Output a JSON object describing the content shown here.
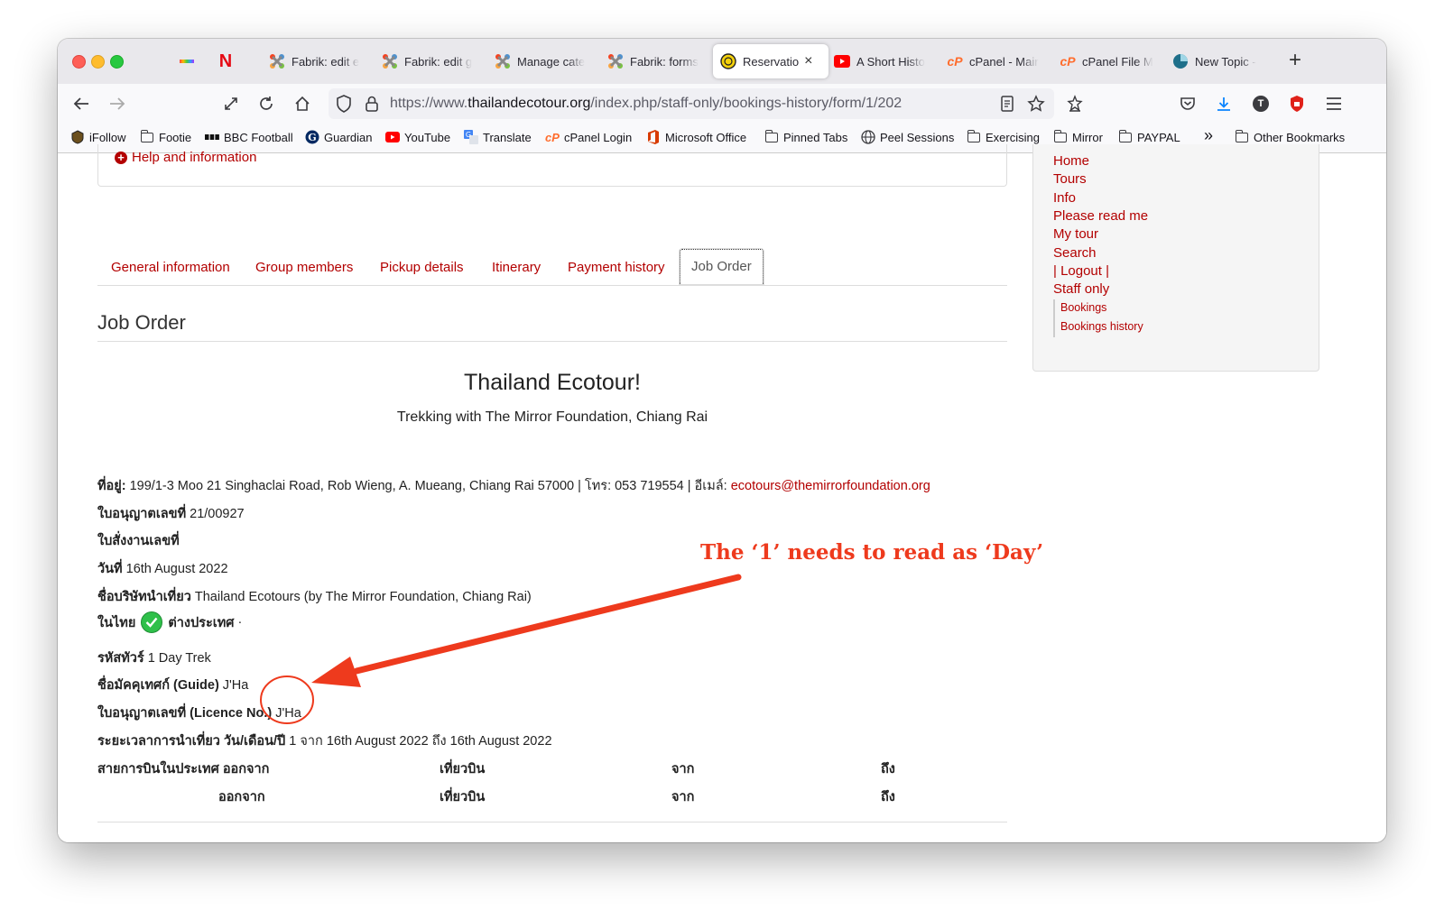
{
  "browser": {
    "tabs": [
      {
        "label": "Fabrik: edit e",
        "icon": "joomla-icon"
      },
      {
        "label": "Fabrik: edit g",
        "icon": "joomla-icon"
      },
      {
        "label": "Manage cate",
        "icon": "joomla-icon"
      },
      {
        "label": "Fabrik: forms",
        "icon": "joomla-icon"
      },
      {
        "label": "Reservatio",
        "icon": "site-logo-icon",
        "active": true
      },
      {
        "label": "A Short Histo",
        "icon": "youtube-icon"
      },
      {
        "label": "cPanel - Mair",
        "icon": "cpanel-icon"
      },
      {
        "label": "cPanel File M",
        "icon": "cpanel-icon"
      },
      {
        "label": "New Topic - ",
        "icon": "forum-icon"
      }
    ],
    "new_tab_label": "+",
    "close_label": "×",
    "url": {
      "scheme": "https://www.",
      "domain": "thailandecotour.org",
      "path": "/index.php/staff-only/bookings-history/form/1/202"
    },
    "bookmarks": [
      {
        "label": "iFollow",
        "icon": "ifollow-icon"
      },
      {
        "label": "Footie",
        "icon": "folder-icon"
      },
      {
        "label": "BBC Football",
        "icon": "bbc-icon"
      },
      {
        "label": "Guardian",
        "icon": "guardian-icon"
      },
      {
        "label": "YouTube",
        "icon": "youtube-icon"
      },
      {
        "label": "Translate",
        "icon": "translate-icon"
      },
      {
        "label": "cPanel Login",
        "icon": "cpanel-icon"
      },
      {
        "label": "Microsoft Office",
        "icon": "office-icon"
      },
      {
        "label": "Pinned Tabs",
        "icon": "folder-icon"
      },
      {
        "label": "Peel Sessions",
        "icon": "globe-icon"
      },
      {
        "label": "Exercising",
        "icon": "folder-icon"
      },
      {
        "label": "Mirror",
        "icon": "folder-icon"
      },
      {
        "label": "PAYPAL",
        "icon": "folder-icon"
      }
    ],
    "overflow_label": "»",
    "other_bookmarks": "Other Bookmarks"
  },
  "page": {
    "help_link": "Help and information",
    "tabs": [
      "General information",
      "Group members",
      "Pickup details",
      "Itinerary",
      "Payment history",
      "Job Order"
    ],
    "active_tab": "Job Order",
    "section_title": "Job Order",
    "company_title": "Thailand Ecotour!",
    "company_subtitle": "Trekking with The Mirror Foundation, Chiang Rai",
    "address": {
      "label": "ที่อยู่:",
      "text": "199/1-3 Moo 21 Singhaclai Road, Rob Wieng, A. Mueang, Chiang Rai 57000 | โทร: 053 719554 | อีเมล์:",
      "email": "ecotours@themirrorfoundation.org"
    },
    "license": {
      "label": "ใบอนุญาตเลขที่",
      "value": "21/00927"
    },
    "job_order_no": {
      "label": "ใบสั่งงานเลขที่",
      "value": ""
    },
    "date": {
      "label": "วันที่",
      "value": "16th August 2022"
    },
    "company_name": {
      "label": "ชื่อบริษัทนำเที่ยว",
      "value": "Thailand Ecotours (by The Mirror Foundation, Chiang Rai)"
    },
    "domestic": {
      "label": "ในไทย",
      "foreign_label": "ต่างประเทศ",
      "foreign_value": "·"
    },
    "tour_code": {
      "label": "รหัสทัวร์",
      "value": "1 Day Trek"
    },
    "guide": {
      "label": "ชื่อมัคคุเทศก์ (Guide)",
      "value": "J'Ha"
    },
    "guide_license": {
      "label": "ใบอนุญาตเลขที่ (Licence No.)",
      "value": "J'Ha"
    },
    "duration": {
      "label": "ระยะเวลาการนำเที่ยว",
      "unit": "วัน/เดือน/ปี",
      "count": "1",
      "from_label": "จาก",
      "from": "16th August 2022",
      "to_label": "ถึง",
      "to": "16th August 2022"
    },
    "flights": {
      "row1": {
        "label": "สายการบินในประเทศ ออกจาก",
        "flight": "เที่ยวบิน",
        "from": "จาก",
        "to": "ถึง"
      },
      "row2": {
        "label": "ออกจาก",
        "flight": "เที่ยวบิน",
        "from": "จาก",
        "to": "ถึง"
      }
    },
    "side_menu": {
      "items": [
        "Home",
        "Tours",
        "Info",
        "Please read me",
        "My tour",
        "Search",
        "| Logout |",
        "Staff only"
      ],
      "sub_items": [
        "Bookings",
        "Bookings history"
      ]
    }
  },
  "annotation": {
    "text": "The ‘1’ needs to read as ‘Day’",
    "color": "#ee3a1d"
  }
}
